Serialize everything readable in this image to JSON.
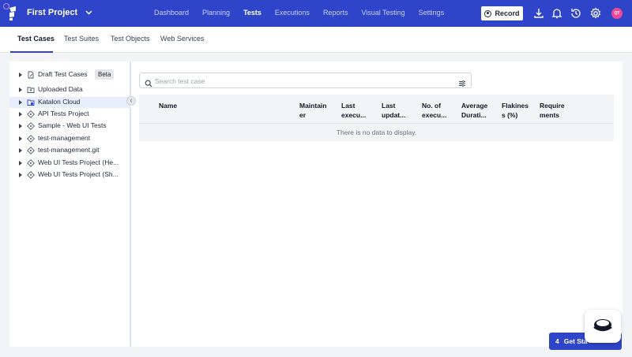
{
  "header": {
    "project_name": "First Project",
    "nav": [
      "Dashboard",
      "Planning",
      "Tests",
      "Executions",
      "Reports",
      "Visual Testing",
      "Settings"
    ],
    "active_nav": "Tests",
    "record_label": "Record",
    "avatar_initials": "QT",
    "brand_color": "#2f45c9"
  },
  "subtabs": [
    "Test Cases",
    "Test Suites",
    "Test Objects",
    "Web Services"
  ],
  "sidebar": {
    "items": [
      {
        "label": "Draft Test Cases",
        "icon": "draft-file-icon"
      },
      {
        "label": "Uploaded Data",
        "icon": "folder-icon"
      },
      {
        "label": "Katalon Cloud",
        "icon": "cloud-folder-icon"
      },
      {
        "label": "API Tests Project",
        "icon": "git-repo-icon"
      },
      {
        "label": "Sample - Web UI Tests",
        "icon": "git-repo-icon"
      },
      {
        "label": "test-management",
        "icon": "git-repo-icon"
      },
      {
        "label": "test-management.git",
        "icon": "git-repo-icon"
      },
      {
        "label": "Web UI Tests Project (He...",
        "icon": "git-repo-icon"
      },
      {
        "label": "Web UI Tests Project (Sh...",
        "icon": "git-repo-icon"
      }
    ],
    "beta_badge": "Beta"
  },
  "search": {
    "placeholder": "Search test case"
  },
  "table": {
    "columns": [
      "Name",
      "Maintain er",
      "Last execu...",
      "Last updat...",
      "No. of execu...",
      "Average Durati...",
      "Flakines s (%)",
      "Require ments"
    ],
    "empty_message": "There is no data to display."
  },
  "get_started": {
    "count": "4",
    "label": "Get Sta"
  }
}
